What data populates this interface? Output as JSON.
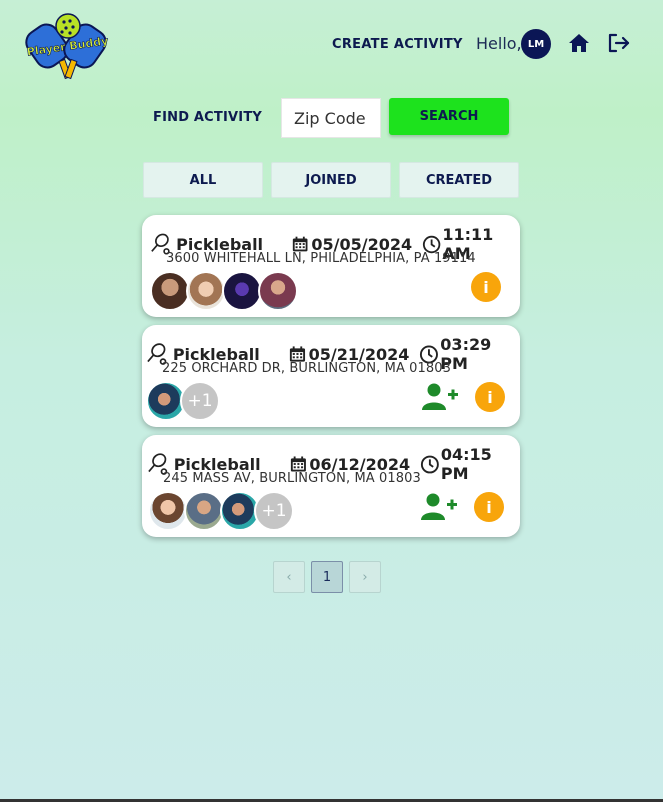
{
  "header": {
    "logo_text": "Player Buddy",
    "create_activity_label": "CREATE ACTIVITY",
    "hello_text": "Hello,",
    "avatar_initials": "LM"
  },
  "find": {
    "label": "FIND ACTIVITY",
    "zip_placeholder": "Zip Code",
    "zip_value": "",
    "search_label": "SEARCH"
  },
  "tabs": [
    {
      "label": "ALL"
    },
    {
      "label": "JOINED"
    },
    {
      "label": "CREATED"
    }
  ],
  "activities": [
    {
      "sport": "Pickleball",
      "date": "05/05/2024",
      "time": "11:11 AM",
      "address": "3600 WHITEHALL LN, PHILADELPHIA, PA 19114",
      "extra_participants": "",
      "can_join": false
    },
    {
      "sport": "Pickleball",
      "date": "05/21/2024",
      "time": "03:29 PM",
      "address": "225 ORCHARD DR, BURLINGTON, MA 01803",
      "extra_participants": "+1",
      "can_join": true
    },
    {
      "sport": "Pickleball",
      "date": "06/12/2024",
      "time": "04:15 PM",
      "address": "245 MASS AV, BURLINGTON, MA 01803",
      "extra_participants": "+1",
      "can_join": true
    }
  ],
  "pagination": {
    "current_page": "1",
    "prev": "‹",
    "next": "›"
  },
  "colors": {
    "accent_green": "#1de21d",
    "navy": "#0d1a4f",
    "info_orange": "#f8a50b",
    "join_green": "#1e8a2a"
  },
  "icons": [
    "home-icon",
    "logout-icon",
    "racket-icon",
    "calendar-icon",
    "clock-icon",
    "add-user-icon",
    "info-icon"
  ]
}
